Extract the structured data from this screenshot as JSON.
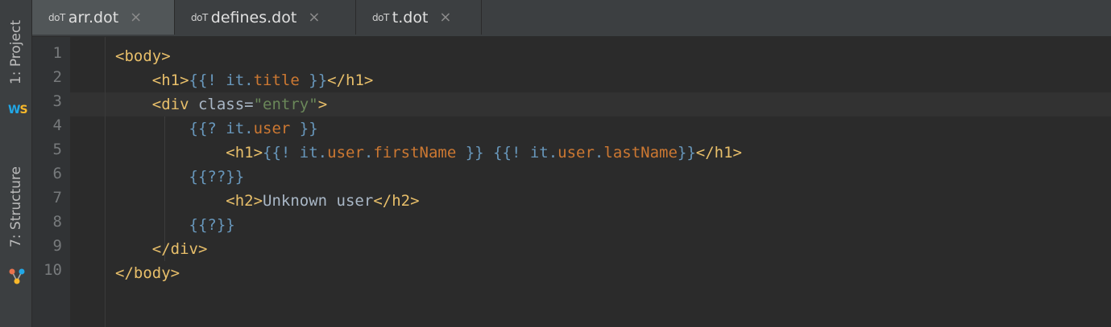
{
  "sidebar": {
    "project_label": "1: Project",
    "structure_label": "7: Structure",
    "app_icon": "webstorm-icon",
    "structure_icon": "structure-icon"
  },
  "tabs": [
    {
      "file_type": "doT",
      "label": "arr.dot",
      "active": true
    },
    {
      "file_type": "doT",
      "label": "defines.dot",
      "active": false
    },
    {
      "file_type": "doT",
      "label": "t.dot",
      "active": false
    }
  ],
  "close_glyph": "×",
  "line_numbers": [
    "1",
    "2",
    "3",
    "4",
    "5",
    "6",
    "7",
    "8",
    "9",
    "10"
  ],
  "code": {
    "l1": [
      "<body>"
    ],
    "l2": [
      "<h1>",
      "{{! it.",
      "title",
      " }}",
      "</h1>"
    ],
    "l3": [
      "<div ",
      "class=",
      "\"entry\"",
      ">"
    ],
    "l4": [
      "{{? it.",
      "user",
      " }}"
    ],
    "l5": [
      "<h1>",
      "{{! it.",
      "user",
      ".",
      "firstName",
      " }}",
      " ",
      "{{! it.",
      "user",
      ".",
      "lastName",
      "}}",
      "</h1>"
    ],
    "l6": [
      "{{??}}"
    ],
    "l7": [
      "<h2>",
      "Unknown user",
      "</h2>"
    ],
    "l8": [
      "{{?}}"
    ],
    "l9": [
      "</div>"
    ],
    "l10": [
      "</body>"
    ]
  },
  "colors": {
    "background": "#2b2b2b",
    "tag": "#e8bf6a",
    "template": "#6897bb",
    "property": "#cc7832",
    "string": "#6a8759",
    "text": "#a9b7c6"
  }
}
